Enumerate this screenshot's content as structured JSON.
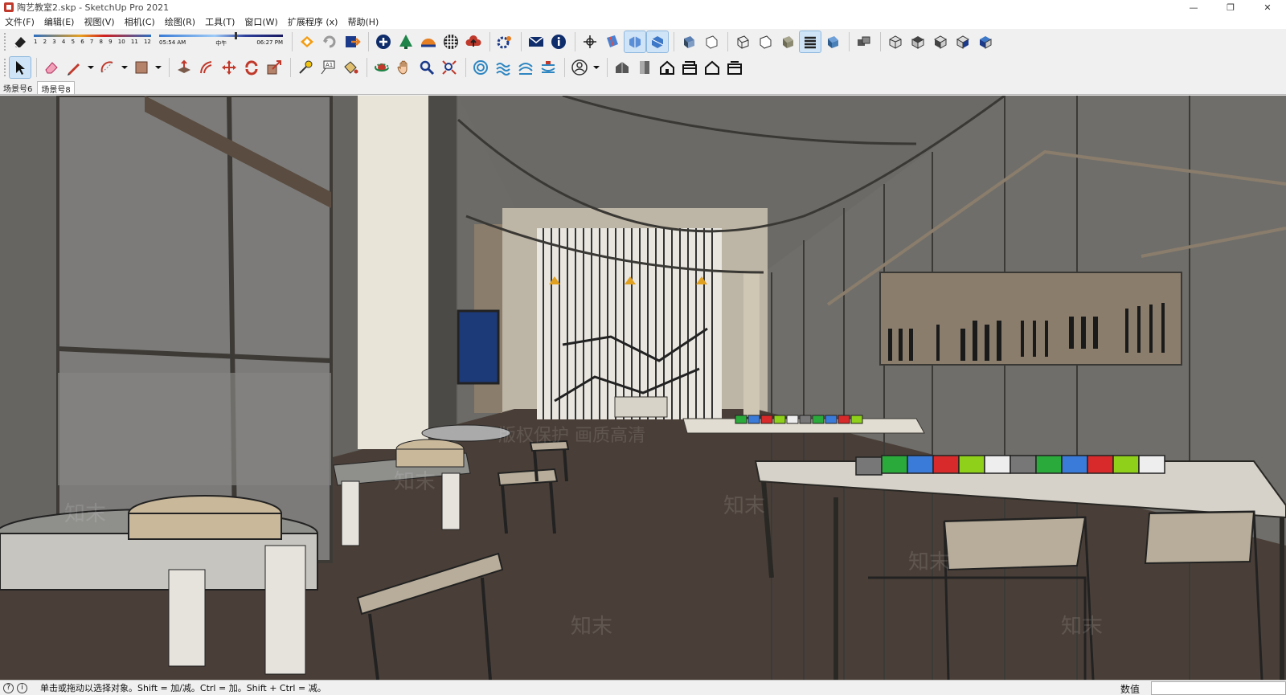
{
  "window": {
    "title": "陶艺教室2.skp - SketchUp Pro 2021",
    "controls": [
      "—",
      "❐",
      "✕"
    ]
  },
  "menu": [
    "文件(F)",
    "编辑(E)",
    "视图(V)",
    "相机(C)",
    "绘图(R)",
    "工具(T)",
    "窗口(W)",
    "扩展程序 (x)",
    "帮助(H)"
  ],
  "shadow_settings": {
    "months": [
      "1",
      "2",
      "3",
      "4",
      "5",
      "6",
      "7",
      "8",
      "9",
      "10",
      "11",
      "12"
    ],
    "time_start": "05:54 AM",
    "time_mid": "中午",
    "time_end": "06:27 PM"
  },
  "scene_tabs": {
    "items": [
      "场景号6",
      "场景号8"
    ],
    "active_index": 1
  },
  "viewport": {
    "watermark": "知末",
    "watermark_caption": "版权保护 画质高清"
  },
  "statusbar": {
    "message": "单击或拖动以选择对象。Shift = 加/减。Ctrl = 加。Shift + Ctrl = 减。",
    "measurements_label": "数值",
    "measurements_value": ""
  },
  "colors": {
    "accent_active": "#cfe4f7",
    "viewport_floor": "#4a3f38",
    "viewport_wall": "#6f6e6b"
  }
}
